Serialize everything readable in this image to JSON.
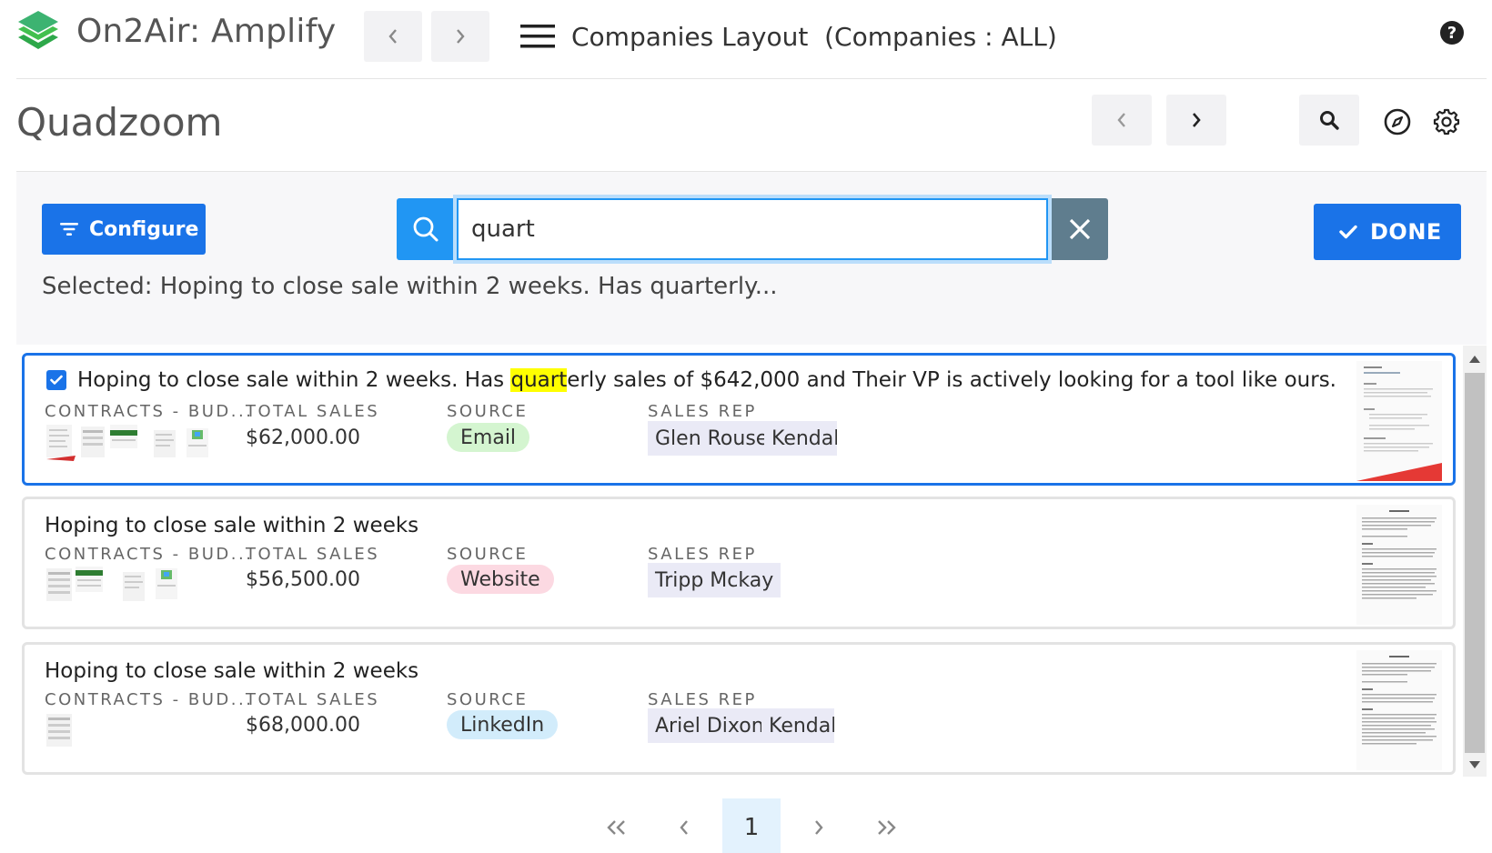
{
  "header": {
    "app_title": "On2Air: Amplify",
    "layout_title": "Companies Layout  (Companies : ALL)"
  },
  "page": {
    "title": "Quadzoom"
  },
  "filter": {
    "configure_label": "Configure",
    "search_value": "quart",
    "done_label": "DONE",
    "selected_text": "Selected: Hoping to close sale within 2 weeks. Has quarterly..."
  },
  "colors": {
    "accent": "#1a73e8",
    "search": "#2196f3",
    "clear": "#5f7d8e",
    "highlight": "#ffff00"
  },
  "labels": {
    "contracts": "CONTRACTS - BUD...",
    "total_sales": "TOTAL SALES",
    "source": "SOURCE",
    "sales_rep": "SALES REP"
  },
  "records": [
    {
      "title_pre": "Hoping to close sale within 2 weeks. Has ",
      "title_match": "quart",
      "title_post": "erly sales of $642,000 and Their VP is actively looking for a tool like ours.",
      "total_sales": "$62,000.00",
      "source": "Email",
      "reps": [
        "Glen Rouse",
        "Kendal Carl"
      ]
    },
    {
      "title": "Hoping to close sale within 2 weeks",
      "total_sales": "$56,500.00",
      "source": "Website",
      "reps": [
        "Tripp Mckay"
      ]
    },
    {
      "title": "Hoping to close sale within 2 weeks",
      "total_sales": "$68,000.00",
      "source": "LinkedIn",
      "reps": [
        "Ariel Dixon",
        "Kendal Carl"
      ]
    }
  ],
  "pagination": {
    "first": "«",
    "prev": "‹",
    "current": "1",
    "next": "›",
    "last": "»"
  }
}
